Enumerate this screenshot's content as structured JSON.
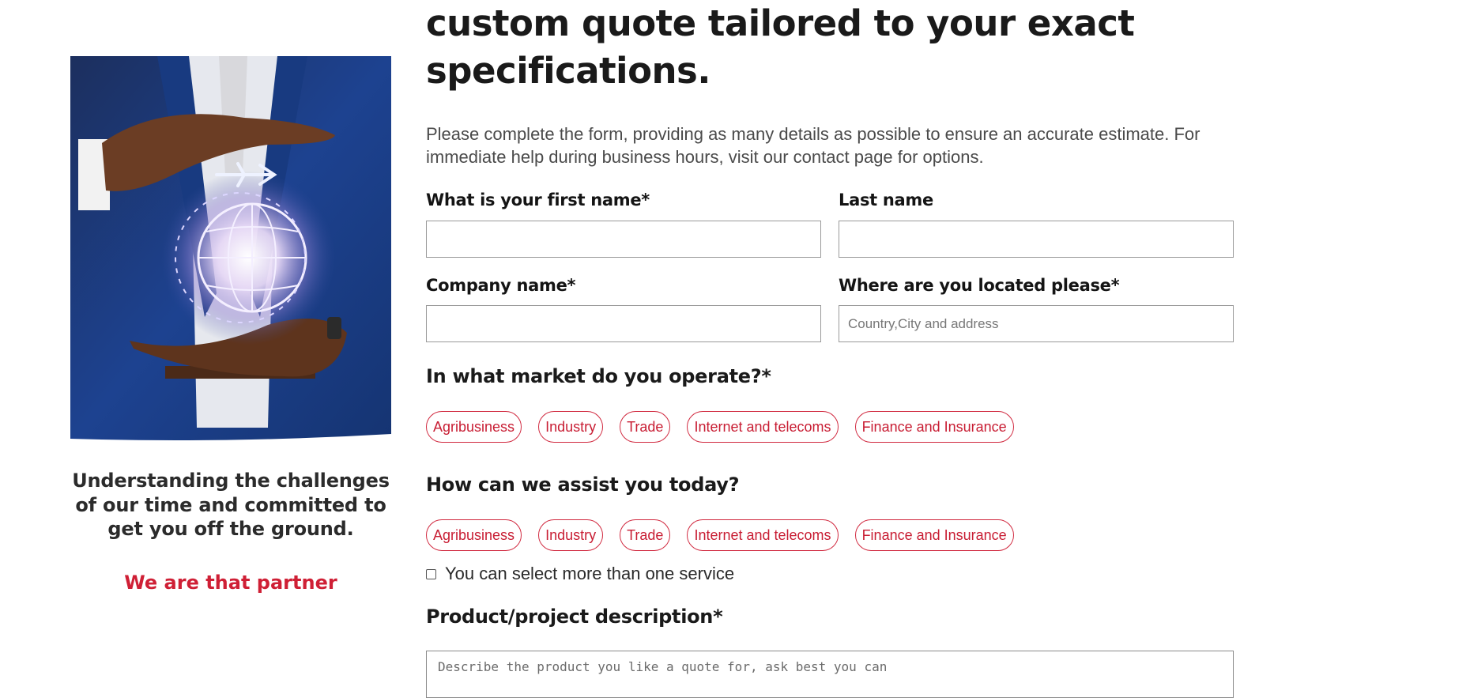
{
  "promo": {
    "text": "Understanding the challenges of our time and committed to get you off the ground.",
    "tagline": "We are that partner",
    "colors": {
      "suit": "#1c3f82",
      "glow": "#ffffff",
      "tagline": "#cf1f35"
    }
  },
  "form": {
    "heading": "custom quote tailored to your exact specifications.",
    "intro": "Please complete the form, providing as many details as possible to ensure an accurate estimate. For immediate help during business hours, visit our contact page for options.",
    "first_name": {
      "label": "What is your first name*",
      "value": "",
      "placeholder": ""
    },
    "last_name": {
      "label": "Last name",
      "value": "",
      "placeholder": ""
    },
    "company": {
      "label": "Company name*",
      "value": "",
      "placeholder": ""
    },
    "location": {
      "label": "Where are you located please*",
      "value": "",
      "placeholder": "Country,City and address"
    },
    "market": {
      "label": "In what market do you operate?*",
      "options": [
        "Agribusiness",
        "Industry",
        "Trade",
        "Internet and telecoms",
        "Finance and Insurance"
      ]
    },
    "assist": {
      "label": "How can we assist you today?",
      "options": [
        "Agribusiness",
        "Industry",
        "Trade",
        "Internet and telecoms",
        "Finance and Insurance"
      ]
    },
    "multi_select_note": "You can select more than one service",
    "description": {
      "label": "Product/project description*",
      "placeholder": "Describe the product you like a quote for, ask best you can"
    },
    "accent_color": "#c81d33"
  }
}
